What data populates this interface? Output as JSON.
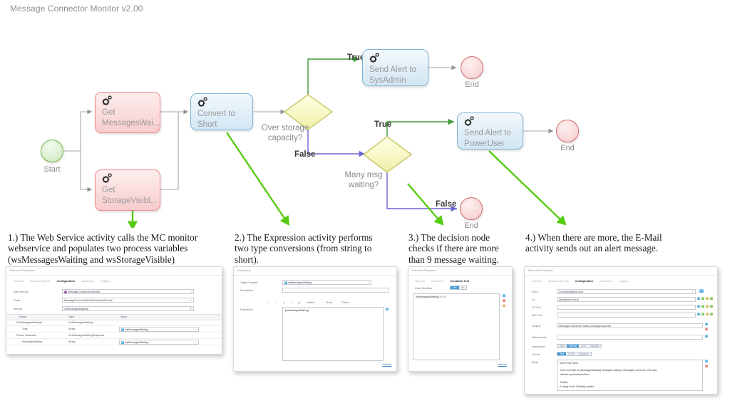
{
  "app": {
    "title": "Message Connector Monitor v2.00"
  },
  "flow": {
    "nodes": [
      {
        "id": "start",
        "type": "start-circle",
        "caption": "Start"
      },
      {
        "id": "getmsg",
        "type": "webservice",
        "label": "Get\nMessagesWai...",
        "icon": "gear-icon",
        "color": "#f08a8a"
      },
      {
        "id": "getstor",
        "type": "webservice",
        "label": "Get\nStorageVisibl...",
        "icon": "gear-icon",
        "color": "#f08a8a"
      },
      {
        "id": "convert",
        "type": "expression",
        "label": "Convert to\nShort",
        "icon": "gear-icon",
        "color": "#7fb4d6"
      },
      {
        "id": "dec1",
        "type": "decision",
        "label": "Over storage\ncapacity?"
      },
      {
        "id": "dec2",
        "type": "decision",
        "label": "Many msg\nwaiting?"
      },
      {
        "id": "sysadmin",
        "type": "email",
        "label": "Send Alert to\nSysAdmin",
        "icon": "gear-icon",
        "color": "#7fb4d6"
      },
      {
        "id": "poweruser",
        "type": "email",
        "label": "Send Alert to\nPowerUser",
        "icon": "gear-icon",
        "color": "#7fb4d6"
      },
      {
        "id": "end1",
        "type": "end-circle",
        "caption": "End"
      },
      {
        "id": "end2",
        "type": "end-circle",
        "caption": "End"
      },
      {
        "id": "end3",
        "type": "end-circle",
        "caption": "End"
      }
    ],
    "edge_labels": {
      "dec1_true": "True",
      "dec1_false": "False",
      "dec2_true": "True",
      "dec2_false": "False"
    },
    "colors": {
      "true_edge": "#3e9a34",
      "false_edge": "#6b63d6",
      "plain_edge": "#a7a7a7",
      "annotation_arrow": "#55cc11",
      "decision_fill": "#fbfbd2",
      "decision_stroke": "#c9c96a",
      "start_stroke": "#74b34a",
      "end_stroke": "#d46a6a"
    }
  },
  "captions": [
    {
      "n": "1",
      "text": "1.) The Web Service activity calls the MC monitor webservice and populates two process variables (wsMessagesWaiting and wsStorageVisible)"
    },
    {
      "n": "2",
      "text": "2.) The Expression activity performs two type conversions (from string to short)."
    },
    {
      "n": "3",
      "text": "3.) The decision node checks if there are more than 9 message waiting."
    },
    {
      "n": "4",
      "text": "4.) When there are more, the E-Mail activity sends out an alert message."
    }
  ],
  "panel1": {
    "title": "Extended Properties",
    "tabs": [
      {
        "label": "General",
        "selected": false
      },
      {
        "label": "Business Events",
        "selected": false
      },
      {
        "label": "Configuration",
        "selected": true
      },
      {
        "label": "Advanced",
        "selected": false
      },
      {
        "label": "Triggers",
        "selected": false
      }
    ],
    "fields": [
      {
        "label": "Web Service",
        "value": "Message Connector Monitor",
        "clear": "×"
      },
      {
        "label": "Class",
        "value": "MessageConnectorMonitor.MonitorService",
        "caret": "▼"
      },
      {
        "label": "Method",
        "value": "GetMessagesWaiting",
        "caret": "▼"
      }
    ],
    "table": {
      "headers": [
        "Name",
        "Type",
        "Value"
      ],
      "rows": [
        {
          "name": "GetMessagesWaiting1",
          "type": "GetMessagesWaiting",
          "value": "",
          "group": true
        },
        {
          "name": "Type",
          "type": "String",
          "value": "wsMessagesWaiting",
          "group": false
        },
        {
          "name": "Return Parameter",
          "type": "GetMessagesWaitingResponse",
          "value": "",
          "group": true
        },
        {
          "name": "MessagesWaiting",
          "type": "String",
          "value": "wsMessagesWaiting",
          "group": false
        }
      ]
    }
  },
  "panel2": {
    "title": "Expression",
    "fields": [
      {
        "label": "Target Variable",
        "value": "wsMessagesWaiting",
        "clear": "×"
      },
      {
        "label": "Description",
        "value": ""
      }
    ],
    "toolbar": [
      "+",
      "−",
      "∗",
      "/",
      "( )",
      "Math ▾",
      "Text ▾",
      "Date ▾"
    ],
    "expression_label": "Expression",
    "expression_value": "[wsMessagesWaiting]",
    "validate_label": "Validate"
  },
  "panel3": {
    "title": "Extended Properties",
    "tabs": [
      {
        "label": "General",
        "selected": false
      },
      {
        "label": "Advanced",
        "selected": false
      },
      {
        "label": "Condition Text",
        "selected": true
      }
    ],
    "case_sensitive_label": "Case Sensitive",
    "case_sensitive_options": [
      {
        "label": "Yes",
        "selected": true
      },
      {
        "label": "No",
        "selected": false
      }
    ],
    "condition_value": "[wsMessagesWaiting] >= 10",
    "validate_label": "Validate"
  },
  "panel4": {
    "title": "Extended Properties",
    "tabs": [
      {
        "label": "General",
        "selected": false
      },
      {
        "label": "Business Events",
        "selected": false
      },
      {
        "label": "Configuration",
        "selected": true
      },
      {
        "label": "Advanced",
        "selected": false
      },
      {
        "label": "Triggers",
        "selected": false
      }
    ],
    "fields": [
      {
        "label": "From",
        "value": "no-reply@acme.local"
      },
      {
        "label": "To",
        "value": "jdoe@acme.local"
      },
      {
        "label": "CC List",
        "value": ""
      },
      {
        "label": "BCC List",
        "value": ""
      },
      {
        "label": "Subject",
        "value": "Message Connector: Many messages queued"
      },
      {
        "label": "Attachments",
        "value": ""
      }
    ],
    "importance_label": "Importance",
    "importance_options": [
      {
        "label": "High",
        "selected": false
      },
      {
        "label": "Normal",
        "selected": true
      },
      {
        "label": "Low",
        "selected": false
      },
      {
        "label": "Dynamic",
        "selected": false
      }
    ],
    "format_label": "Format",
    "format_options": [
      {
        "label": "Text",
        "selected": true
      },
      {
        "label": "HTML",
        "selected": false
      },
      {
        "label": "Dynamic",
        "selected": false
      }
    ],
    "body_label": "Body",
    "body_lines": [
      "Dear Power User,",
      "",
      "There currently are [MessagesWaiting] Messages waiting in Message Connector. This may",
      "indicate a potential problem.",
      "",
      "Thanks,",
      "A caring Kofax Totalityity system."
    ]
  }
}
